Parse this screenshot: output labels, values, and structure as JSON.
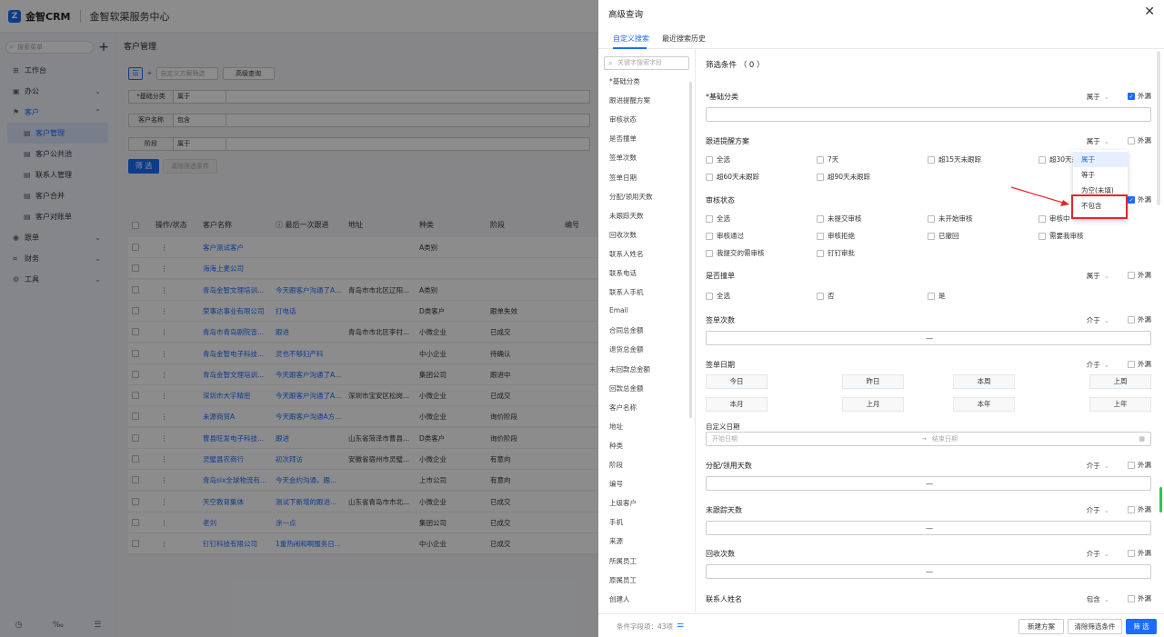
{
  "header": {
    "brand": "金智CRM",
    "center": "金智软渠服务中心"
  },
  "sidebar": {
    "search_placeholder": "搜索菜单",
    "items": [
      {
        "icon": "⊞",
        "label": "工作台",
        "chevron": ""
      },
      {
        "icon": "▣",
        "label": "办公",
        "chevron": "⌄"
      },
      {
        "icon": "⚑",
        "label": "客户",
        "chevron": "⌃"
      }
    ],
    "sub_items": [
      "客户管理",
      "客户公共池",
      "联系人管理",
      "客户合并",
      "客户对账单"
    ],
    "items2": [
      {
        "icon": "◉",
        "label": "跟单",
        "chevron": "⌄"
      },
      {
        "icon": "¤",
        "label": "财务",
        "chevron": "⌄"
      },
      {
        "icon": "⚙",
        "label": "工具",
        "chevron": "⌄"
      }
    ],
    "bottom": [
      "◷",
      "‰",
      "☰"
    ]
  },
  "main": {
    "title": "客户管理",
    "scheme_placeholder": "自定义方案筛选",
    "advanced_label": "高级查询",
    "filters": [
      {
        "label": "*基础分类",
        "op": "属于"
      },
      {
        "label": "客户名称",
        "op": "包含"
      },
      {
        "label": "阶段",
        "op": "属于"
      }
    ],
    "filter_btn": "筛 选",
    "clear_btn": "清除筛选条件",
    "columns": [
      "操作/状态",
      "客户名称",
      "ⓘ 最后一次跟进",
      "地址",
      "种类",
      "阶段",
      "编号"
    ],
    "rows": [
      [
        "⋮",
        "客户测试客户",
        "",
        "",
        "A类别",
        "",
        ""
      ],
      [
        "⋮",
        "海海上麦公司",
        "",
        "",
        "",
        "",
        ""
      ],
      [
        "⋮",
        "青岛金智文理培训...",
        "今天跟客户沟通了A...",
        "青岛市市北区辽阳...",
        "A类别",
        "",
        ""
      ],
      [
        "⋮",
        "荣事达事业有限公司",
        "打电话",
        "",
        "D类客户",
        "跟单失效",
        ""
      ],
      [
        "⋮",
        "青岛市青岛剧院音...",
        "跟进",
        "青岛市市北区李村...",
        "小微企业",
        "已成交",
        ""
      ],
      [
        "⋮",
        "青岛金智电子科技...",
        "灵也不够妇产科",
        "",
        "中小企业",
        "待确认",
        ""
      ],
      [
        "⋮",
        "青岛金智文理培训...",
        "今天跟客户沟通了A...",
        "",
        "集团公司",
        "跟进中",
        ""
      ],
      [
        "⋮",
        "深圳市大宇精密",
        "今天跟客户沟通了A...",
        "深圳市宝安区松岗...",
        "小微企业",
        "已成交",
        ""
      ],
      [
        "⋮",
        "未源商贸A",
        "今天跟客户沟通A方...",
        "",
        "小微企业",
        "询价阶段",
        ""
      ],
      [
        "⋮",
        "曹县旺发电子科技...",
        "跟进",
        "山东省菏泽市曹县...",
        "D类客户",
        "询价阶段",
        ""
      ],
      [
        "⋮",
        "灵璧县农商行",
        "初次拜访",
        "安徽省宿州市灵璧...",
        "小微企业",
        "有意向",
        ""
      ],
      [
        "⋮",
        "青岛six全球物流有...",
        "今天会约沟通，跟...",
        "",
        "上市公司",
        "有意向",
        ""
      ],
      [
        "⋮",
        "天空教育集体",
        "测试下新增的跟进...",
        "山东省青岛市市北...",
        "小微企业",
        "已成交",
        ""
      ],
      [
        "⋮",
        "老刘",
        "涂一点",
        "",
        "集团公司",
        "已成交",
        ""
      ],
      [
        "⋮",
        "钉钉科技有限公司",
        "1重热闹和啊服务日...",
        "",
        "中小企业",
        "已成交",
        ""
      ]
    ]
  },
  "panel": {
    "title": "高级查询",
    "close": "✕",
    "tabs": [
      "自定义搜索",
      "最近搜索历史"
    ],
    "field_search_placeholder": "关键字搜索字段",
    "fields": [
      "*基础分类",
      "跟进提醒方案",
      "审核状态",
      "是否撞单",
      "签单次数",
      "签单日期",
      "分配/领用天数",
      "未跟踪天数",
      "回收次数",
      "联系人姓名",
      "联系电话",
      "联系人手机",
      "Email",
      "合同总金额",
      "退货总金额",
      "未回款总金额",
      "回款总金额",
      "客户名称",
      "地址",
      "种类",
      "阶段",
      "编号",
      "上级客户",
      "手机",
      "来源",
      "所属员工",
      "原属员工",
      "创建人"
    ],
    "cond_title": "筛选条件 （ 0 ）",
    "ex_label": "外漏",
    "sections": {
      "base": {
        "title": "*基础分类",
        "op": "属于"
      },
      "remind": {
        "title": "跟进提醒方案",
        "op": "属于",
        "options": [
          "全选",
          "7天",
          "超15天未跟踪",
          "超30天未",
          "超60天未跟踪",
          "超90天未跟踪"
        ]
      },
      "audit": {
        "title": "审核状态",
        "options": [
          "全选",
          "未提交审核",
          "未开始审核",
          "审核中",
          "审核通过",
          "审核拒绝",
          "已撤回",
          "需要我审核",
          "我提交的需审核",
          "钉钉审批"
        ]
      },
      "dup": {
        "title": "是否撞单",
        "op": "属于",
        "options": [
          "全选",
          "否",
          "是"
        ]
      },
      "sign_count": {
        "title": "签单次数",
        "op": "介于",
        "dash": "—"
      },
      "sign_date": {
        "title": "签单日期",
        "op": "介于",
        "quick": [
          "今日",
          "昨日",
          "本周",
          "上周",
          "本月",
          "上月",
          "本年",
          "上年"
        ],
        "custom_label": "自定义日期",
        "start": "开始日期",
        "arrow": "→",
        "end": "结束日期"
      },
      "alloc": {
        "title": "分配/领用天数",
        "op": "介于",
        "dash": "—"
      },
      "untrack": {
        "title": "未跟踪天数",
        "op": "介于",
        "dash": "—"
      },
      "recycle": {
        "title": "回收次数",
        "op": "介于",
        "dash": "—"
      },
      "contact": {
        "title": "联系人姓名",
        "op": "包含"
      }
    },
    "dropdown": [
      "属于",
      "等于",
      "为空(未填)",
      "不包含"
    ],
    "footer": {
      "count": "条件字段项：43项",
      "new_scheme": "新建方案",
      "clear": "清除筛选条件",
      "filter": "筛 选"
    }
  },
  "colors": {
    "accent": "#1a6dff",
    "highlight": "#e8232a"
  }
}
